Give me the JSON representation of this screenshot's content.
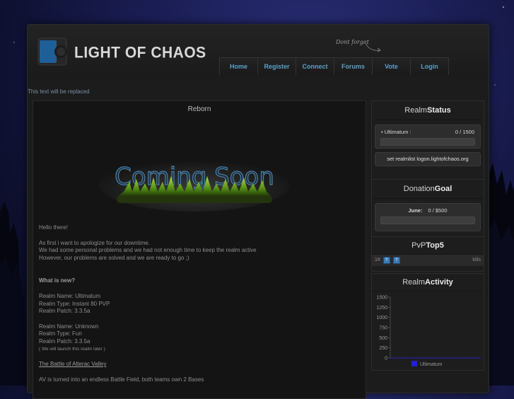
{
  "header": {
    "site_title": "LIGHT OF CHAOS",
    "dont_forget": "Dont forget"
  },
  "nav": {
    "items": [
      {
        "label": "Home"
      },
      {
        "label": "Register"
      },
      {
        "label": "Connect"
      },
      {
        "label": "Forums"
      },
      {
        "label": "Vote"
      },
      {
        "label": "Login"
      }
    ]
  },
  "replace_text": "This text will be replaced",
  "main": {
    "title": "Reborn",
    "banner_text": "Coming Soon",
    "greeting": "Hello there!",
    "intro_lines": [
      "As first i want to apologize for our downtime.",
      "We had some personal problems and we had not enough time to keep the realm active",
      "However, our problems are solved and we are ready to go ;)"
    ],
    "whats_new_heading": "What is new?",
    "realm1_lines": [
      "Realm Name: Ultimatum",
      "Realm Type: Instant 80 PVP",
      "Realm Patch: 3.3.5a"
    ],
    "realm2_lines": [
      "Realm Name: Unknown",
      "Realm Type: Fun",
      "Realm Patch: 3.3.5a"
    ],
    "realm2_note": "( We will launch this realm later )",
    "av_heading": "The Battle of Alterac Valley",
    "av_line1": "AV is turned into an endless Battle Field, both teams own 2 Bases"
  },
  "realm_status": {
    "title_plain": "Realm",
    "title_bold": "Status",
    "realm_name": "• Ultimatum :",
    "realm_players": "0 / 1500",
    "realmlist": "set realmlist logon.lightofchaos.org"
  },
  "donation_goal": {
    "title_plain": "Donation",
    "title_bold": "Goal",
    "month": "June:",
    "amount": "0 / $500"
  },
  "pvp_top": {
    "title_plain": "PvP",
    "title_bold": "Top5",
    "rank": "1#",
    "name_icon": "?",
    "race_icon": "?",
    "kills_label": "kills"
  },
  "realm_activity": {
    "title_plain": "Realm",
    "title_bold": "Activity"
  },
  "chart_data": {
    "type": "line",
    "y_ticks": [
      1500,
      1250,
      1000,
      750,
      500,
      250,
      0
    ],
    "ylim": [
      0,
      1500
    ],
    "series": [
      {
        "name": "Ultimatum",
        "values": [
          0,
          0
        ],
        "color": "#2222cc"
      }
    ],
    "legend_position": "bottom"
  },
  "colors": {
    "accent_blue": "#5aa0c8",
    "panel_bg": "#1d1d1d",
    "series_blue": "#2222cc"
  }
}
